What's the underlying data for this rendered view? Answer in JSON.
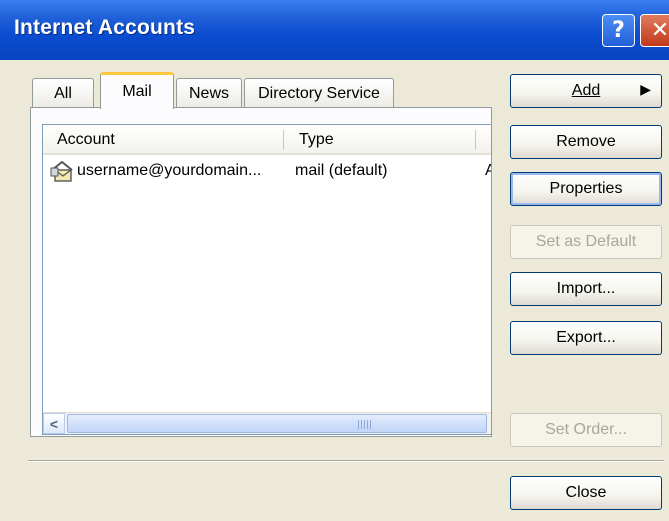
{
  "window": {
    "title": "Internet Accounts"
  },
  "tabs": [
    {
      "label": "All",
      "active": false
    },
    {
      "label": "Mail",
      "active": true
    },
    {
      "label": "News",
      "active": false
    },
    {
      "label": "Directory Service",
      "active": false
    }
  ],
  "list": {
    "columns": [
      "Account",
      "Type"
    ],
    "rows": [
      {
        "icon": "mail-account-icon",
        "account": "username@yourdomain...",
        "type": "mail (default)",
        "extra": "A"
      }
    ]
  },
  "buttons": {
    "add": "Add",
    "remove": "Remove",
    "properties": "Properties",
    "set_default": "Set as Default",
    "import": "Import...",
    "export": "Export...",
    "set_order": "Set Order...",
    "close": "Close"
  },
  "colors": {
    "titlebar": "#0a4cd0",
    "active_tab_highlight": "#ffc83c",
    "dialog_bg": "#ece9d8"
  }
}
